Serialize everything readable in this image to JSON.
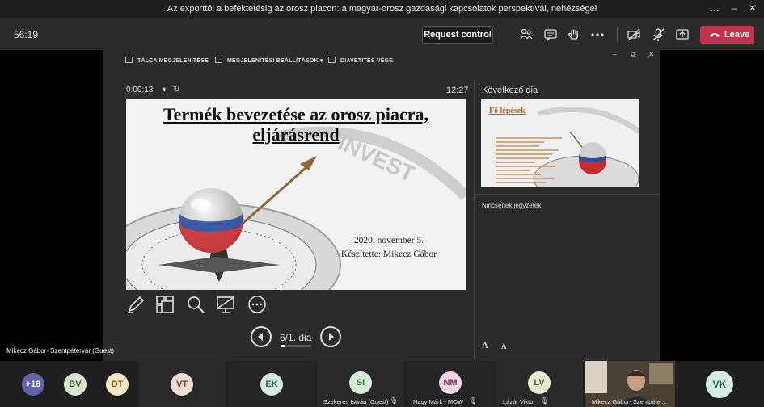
{
  "window": {
    "title": "Az exporttól a befektetésig az orosz piacon: a magyar-orosz gazdasági kapcsolatok perspektívái, nehézségei",
    "controls": [
      "…",
      "–",
      "☐",
      "✕"
    ]
  },
  "meeting": {
    "duration": "56:19",
    "request_control_label": "Request control",
    "leave_label": "Leave"
  },
  "presenter": {
    "toolbar": {
      "show_taskbar": "TÁLCA MEGJELENÍTÉSE",
      "display_settings": "MEGJELENÍTÉSI BEÁLLÍTÁSOK ▾",
      "end_slideshow": "DIAVETÍTÉS VÉGE"
    },
    "window_controls": [
      "–",
      "⧉",
      "✕"
    ],
    "elapsed": "0:00:13",
    "clock": "12:27",
    "slide": {
      "title_line1": "Termék bevezetése az orosz piacra,",
      "title_line2": "eljárásrend",
      "date": "2020. november 5.",
      "author": "Készítette: Mikecz Gábor",
      "watermark": "INVEST"
    },
    "slide_counter": "6/1. dia",
    "progress": 0.17,
    "next_label": "Következő dia",
    "next_slide_title": "Fő lépések",
    "notes": "Nincsenek jegyzetek.",
    "font_larger": "A",
    "font_smaller": "A"
  },
  "presenter_name_tag": "Mikecz Gábor- Szentpétervár (Guest)",
  "participants": {
    "overflow": "+18",
    "avatars": [
      {
        "initials": "BV",
        "color": "#d8e8d0",
        "text": "#3d5a33"
      },
      {
        "initials": "DT",
        "color": "#fbe8c4",
        "text": "#7a5a1d"
      },
      {
        "initials": "VT",
        "color": "#f1dcd3",
        "text": "#6b3f30"
      },
      {
        "initials": "EK",
        "color": "#d3ece0",
        "text": "#2e6148"
      },
      {
        "initials": "SI",
        "color": "#d6efd8",
        "text": "#2f6a38"
      },
      {
        "initials": "NM",
        "color": "#f3d6e6",
        "text": "#7a2f58"
      },
      {
        "initials": "LV",
        "color": "#e6ebd5",
        "text": "#4f5a2a"
      },
      {
        "initials": "VK",
        "color": "#d4ede0",
        "text": "#2d6147"
      }
    ],
    "names": [
      "Szekeres István (Guest)",
      "Nagy Márk - MOW",
      "Lázár Viktor",
      "Mikecz Gábor- Szentpéter..."
    ]
  },
  "colors": {
    "leave": "#c4314b",
    "overflow_badge": "#6264a7",
    "thumb_title": "#c55a11"
  }
}
